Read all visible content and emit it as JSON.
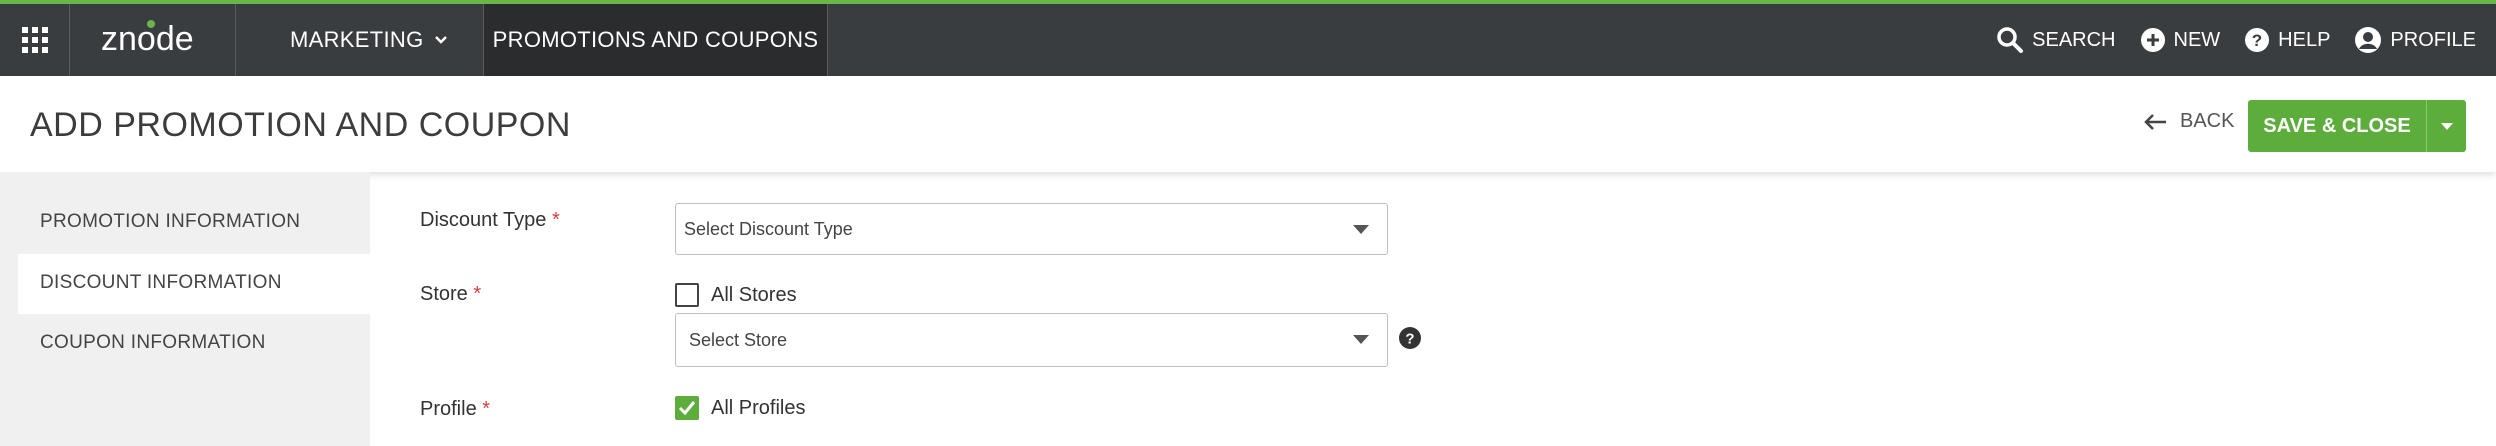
{
  "topbar": {
    "logo_text": "znode",
    "menu_label": "MARKETING",
    "active_tab": "PROMOTIONS AND COUPONS",
    "search": "SEARCH",
    "new": "NEW",
    "help": "HELP",
    "profile": "PROFILE"
  },
  "header": {
    "title": "ADD PROMOTION AND COUPON",
    "back": "BACK",
    "save": "SAVE & CLOSE"
  },
  "sidebar": {
    "items": [
      {
        "label": "PROMOTION INFORMATION"
      },
      {
        "label": "DISCOUNT INFORMATION",
        "active": true
      },
      {
        "label": "COUPON INFORMATION"
      }
    ]
  },
  "form": {
    "discount_type": {
      "label": "Discount Type",
      "required": "*",
      "placeholder": "Select Discount Type"
    },
    "store": {
      "label": "Store",
      "required": "*",
      "checkbox_label": "All Stores",
      "checked": false,
      "placeholder": "Select Store"
    },
    "profile": {
      "label": "Profile",
      "required": "*",
      "checkbox_label": "All Profiles",
      "checked": true
    }
  },
  "colors": {
    "accent": "#5cad3b",
    "topbar": "#3a3d40",
    "required": "#e03a3a"
  }
}
